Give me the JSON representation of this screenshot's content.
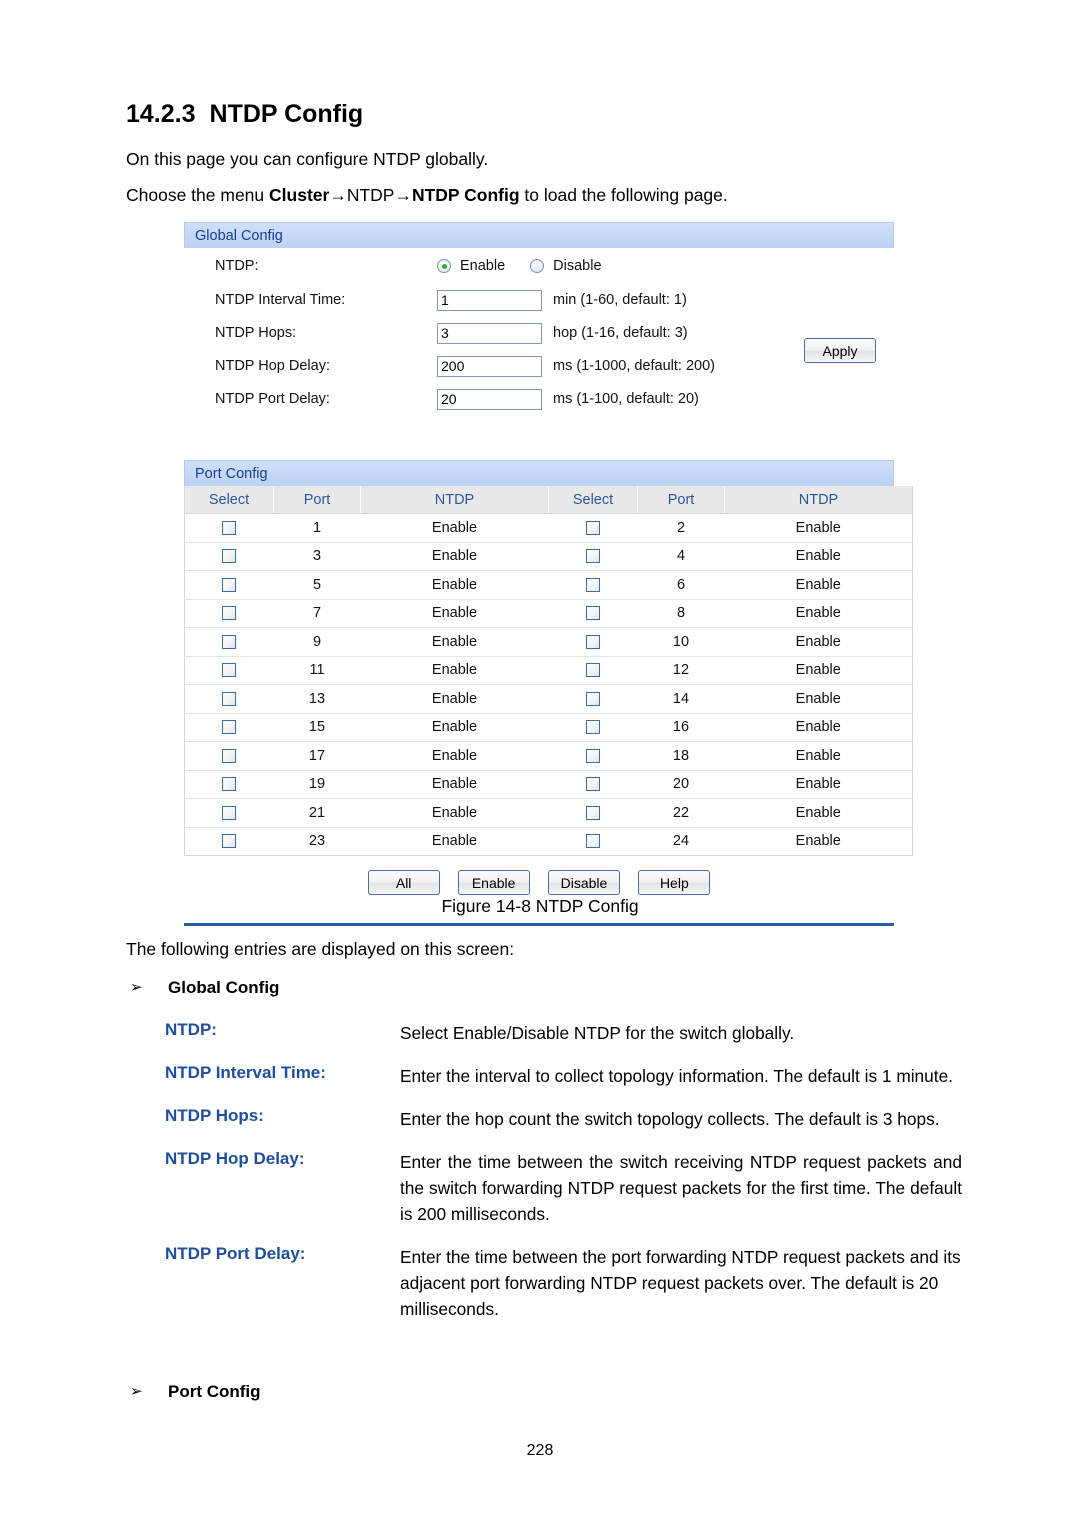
{
  "document": {
    "section_number": "14.2.3",
    "section_title": "NTDP Config",
    "intro": "On this page you can configure NTDP globally.",
    "choose_prefix": "Choose the menu ",
    "choose_menu_1": "Cluster",
    "choose_arrow": "→",
    "choose_menu_2": "NTDP",
    "choose_menu_3": "NTDP Config",
    "choose_suffix": " to load the following page.",
    "figure_caption": "Figure 14-8 NTDP Config",
    "following_entries": "The following entries are displayed on this screen:",
    "page_number": "228",
    "bullet_glyph": "➢"
  },
  "ui": {
    "global_config": {
      "panel_title": "Global Config",
      "ntdp": {
        "label": "NTDP:",
        "options": [
          "Enable",
          "Disable"
        ],
        "selected": "Enable"
      },
      "interval_time": {
        "label": "NTDP Interval Time:",
        "value": "1",
        "hint": "min (1-60, default: 1)"
      },
      "hops": {
        "label": "NTDP Hops:",
        "value": "3",
        "hint": "hop (1-16, default: 3)"
      },
      "hop_delay": {
        "label": "NTDP Hop Delay:",
        "value": "200",
        "hint": "ms (1-1000, default: 200)"
      },
      "port_delay": {
        "label": "NTDP Port Delay:",
        "value": "20",
        "hint": "ms (1-100, default: 20)"
      },
      "apply_label": "Apply"
    },
    "port_config": {
      "panel_title": "Port Config",
      "headers": [
        "Select",
        "Port",
        "NTDP",
        "Select",
        "Port",
        "NTDP"
      ],
      "rows": [
        {
          "left_port": "1",
          "left_ntdp": "Enable",
          "right_port": "2",
          "right_ntdp": "Enable"
        },
        {
          "left_port": "3",
          "left_ntdp": "Enable",
          "right_port": "4",
          "right_ntdp": "Enable"
        },
        {
          "left_port": "5",
          "left_ntdp": "Enable",
          "right_port": "6",
          "right_ntdp": "Enable"
        },
        {
          "left_port": "7",
          "left_ntdp": "Enable",
          "right_port": "8",
          "right_ntdp": "Enable"
        },
        {
          "left_port": "9",
          "left_ntdp": "Enable",
          "right_port": "10",
          "right_ntdp": "Enable"
        },
        {
          "left_port": "11",
          "left_ntdp": "Enable",
          "right_port": "12",
          "right_ntdp": "Enable"
        },
        {
          "left_port": "13",
          "left_ntdp": "Enable",
          "right_port": "14",
          "right_ntdp": "Enable"
        },
        {
          "left_port": "15",
          "left_ntdp": "Enable",
          "right_port": "16",
          "right_ntdp": "Enable"
        },
        {
          "left_port": "17",
          "left_ntdp": "Enable",
          "right_port": "18",
          "right_ntdp": "Enable"
        },
        {
          "left_port": "19",
          "left_ntdp": "Enable",
          "right_port": "20",
          "right_ntdp": "Enable"
        },
        {
          "left_port": "21",
          "left_ntdp": "Enable",
          "right_port": "22",
          "right_ntdp": "Enable"
        },
        {
          "left_port": "23",
          "left_ntdp": "Enable",
          "right_port": "24",
          "right_ntdp": "Enable"
        }
      ],
      "buttons": [
        "All",
        "Enable",
        "Disable",
        "Help"
      ]
    }
  },
  "entries": {
    "global_config_heading": "Global Config",
    "port_config_heading": "Port Config",
    "items": [
      {
        "term": "NTDP:",
        "desc": "Select Enable/Disable NTDP for the switch globally."
      },
      {
        "term": "NTDP Interval Time:",
        "desc": "Enter the interval to collect topology information. The default is 1 minute."
      },
      {
        "term": "NTDP Hops:",
        "desc": "Enter the hop count the switch topology collects. The default is 3 hops."
      },
      {
        "term": "NTDP Hop Delay:",
        "desc": "Enter the time between the switch receiving NTDP request packets and the switch forwarding NTDP request packets for the first time. The default is 200 milliseconds."
      },
      {
        "term": "NTDP Port Delay:",
        "desc": "Enter the time between the port forwarding NTDP request packets and its adjacent port forwarding NTDP request packets over. The default is 20 milliseconds."
      }
    ]
  },
  "colors": {
    "term_blue": "#1f4e9c",
    "panel_header_blue": "#bcd2f4",
    "panel_header_text": "#1b3e8c",
    "table_header_bg": "#e9e9e9",
    "table_header_text": "#2d5698",
    "rule_blue": "#2a5c9e",
    "radio_selected_green": "#27b427"
  }
}
